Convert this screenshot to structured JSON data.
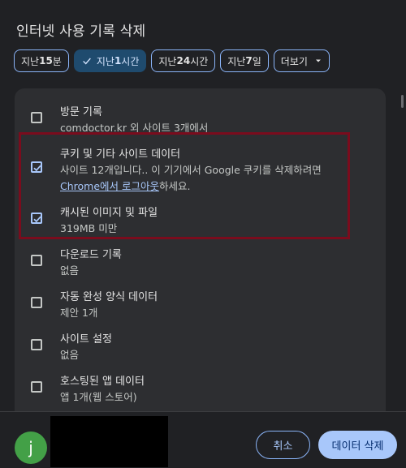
{
  "dialog": {
    "title": "인터넷 사용 기록 삭제"
  },
  "time_range": {
    "chips": [
      {
        "prefix": "지난 ",
        "num": "15",
        "suffix": "분",
        "selected": false
      },
      {
        "prefix": "지난 ",
        "num": "1",
        "suffix": "시간",
        "selected": true
      },
      {
        "prefix": "지난 ",
        "num": "24",
        "suffix": "시간",
        "selected": false
      },
      {
        "prefix": "지난 ",
        "num": "7",
        "suffix": "일",
        "selected": false
      }
    ],
    "more_label": "더보기"
  },
  "items": [
    {
      "title": "방문 기록",
      "sub": "comdoctor.kr 외 사이트 3개에서",
      "checked": false
    },
    {
      "title": "쿠키 및 기타 사이트 데이터",
      "sub": "사이트 12개입니다.. 이 기기에서 Google 쿠키를 삭제하려면",
      "sub_link": "Chrome에서 로그아웃",
      "sub_tail": "하세요.",
      "checked": true
    },
    {
      "title": "캐시된 이미지 및 파일",
      "sub": "319MB 미만",
      "checked": true
    },
    {
      "title": "다운로드 기록",
      "sub": "없음",
      "checked": false
    },
    {
      "title": "자동 완성 양식 데이터",
      "sub": "제안 1개",
      "checked": false
    },
    {
      "title": "사이트 설정",
      "sub": "없음",
      "checked": false
    },
    {
      "title": "호스팅된 앱 데이터",
      "sub": "앱 1개(웹 스토어)",
      "checked": false
    }
  ],
  "footer": {
    "avatar_letter": "j",
    "avatar_color": "#43a047",
    "cancel_label": "취소",
    "delete_label": "데이터 삭제"
  },
  "colors": {
    "accent": "#a8c7fa",
    "highlight_box": "#7a0c1d"
  }
}
